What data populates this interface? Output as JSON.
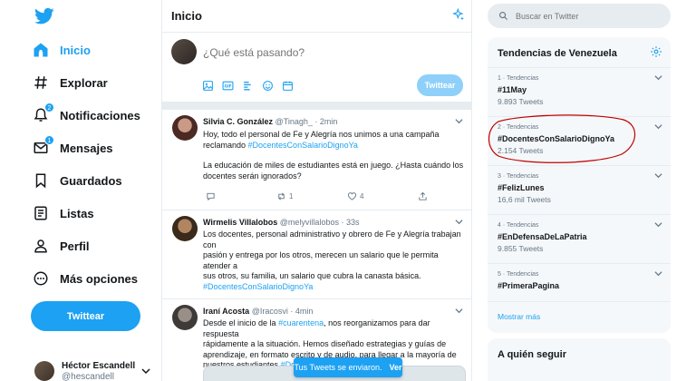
{
  "nav": {
    "items": [
      {
        "label": "Inicio",
        "icon": "home-icon"
      },
      {
        "label": "Explorar",
        "icon": "hashtag-icon"
      },
      {
        "label": "Notificaciones",
        "icon": "bell-icon",
        "badge": "2"
      },
      {
        "label": "Mensajes",
        "icon": "envelope-icon",
        "badge": "1"
      },
      {
        "label": "Guardados",
        "icon": "bookmark-icon"
      },
      {
        "label": "Listas",
        "icon": "list-icon"
      },
      {
        "label": "Perfil",
        "icon": "person-icon"
      },
      {
        "label": "Más opciones",
        "icon": "more-icon"
      }
    ],
    "tweet_button": "Twittear",
    "profile": {
      "name": "Héctor Escandell",
      "handle": "@hescandell"
    }
  },
  "main": {
    "title": "Inicio",
    "compose": {
      "placeholder": "¿Qué está pasando?",
      "button": "Twittear"
    },
    "tweets": [
      {
        "name": "Silvia C. González",
        "handle": "@Tinagh_",
        "time": "· 2min",
        "text_lines": [
          "Hoy, todo el personal de Fe y Alegría nos unimos a una campaña",
          "reclamando "
        ],
        "hashtag": "#DocentesConSalarioDignoYa",
        "text2_lines": [
          "La educación de miles de estudiantes está en juego. ¿Hasta cuándo los",
          "docentes serán ignorados?"
        ],
        "retweets": "1",
        "likes": "4"
      },
      {
        "name": "Wirmelis Villalobos",
        "handle": "@melyvillalobos",
        "time": "· 33s",
        "text_lines": [
          "Los docentes, personal administrativo y obrero de Fe y Alegría trabajan con",
          "pasión y entrega por los otros, merecen un salario que le permita atender a",
          "sus otros, su familia, un salario que cubra la canasta básica."
        ],
        "hashtag": "#DocentesConSalarioDignoYa"
      },
      {
        "name": "Iraní Acosta",
        "handle": "@Iracosvi",
        "time": "· 4min",
        "text_lines": [
          "Desde el inicio de la ",
          "rápidamente a la situación. Hemos diseñado estrategias y guías de",
          "aprendizaje, en formato escrito y de audio, para llegar a la mayoría de",
          "nuestros estudiantes "
        ],
        "hashtag_inline": "#cuarentena",
        "after_hashtag_inline": ", nos reorganizamos para dar respuesta",
        "hashtag_end": "#Doc"
      }
    ],
    "toast": {
      "text": "Tus Tweets se enviaron.",
      "action": "Ver"
    }
  },
  "right": {
    "search_placeholder": "Buscar en Twitter",
    "trends_title": "Tendencias de Venezuela",
    "trends": [
      {
        "meta": "1 · Tendencias",
        "tag": "#11May",
        "count": "9.893 Tweets"
      },
      {
        "meta": "2 · Tendencias",
        "tag": "#DocentesConSalarioDignoYa",
        "count": "2.154 Tweets"
      },
      {
        "meta": "3 · Tendencias",
        "tag": "#FelizLunes",
        "count": "16,6 mil Tweets"
      },
      {
        "meta": "4 · Tendencias",
        "tag": "#EnDefensaDeLaPatria",
        "count": "9.855 Tweets"
      },
      {
        "meta": "5 · Tendencias",
        "tag": "#PrimeraPagina",
        "count": ""
      }
    ],
    "show_more": "Mostrar más",
    "follow_title": "A quién seguir"
  },
  "colors": {
    "accent": "#1da1f2",
    "annotation": "#c00000"
  }
}
